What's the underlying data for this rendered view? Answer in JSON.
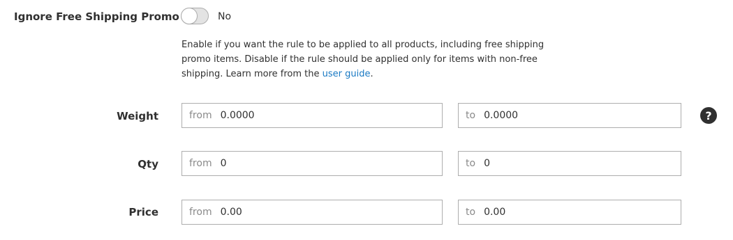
{
  "ignore_promo": {
    "label": "Ignore Free Shipping Promo",
    "toggle_state": "No",
    "note_text": "Enable if you want the rule to be applied to all products, including free shipping promo items. Disable if the rule should be applied only for items with non-free shipping. Learn more from the ",
    "note_link": "user guide",
    "note_end": "."
  },
  "ranges": {
    "weight": {
      "label": "Weight",
      "from_prefix": "from",
      "from_value": "0.0000",
      "to_prefix": "to",
      "to_value": "0.0000"
    },
    "qty": {
      "label": "Qty",
      "from_prefix": "from",
      "from_value": "0",
      "to_prefix": "to",
      "to_value": "0"
    },
    "price": {
      "label": "Price",
      "from_prefix": "from",
      "from_value": "0.00",
      "to_prefix": "to",
      "to_value": "0.00"
    }
  },
  "help_icon": {
    "glyph": "?"
  },
  "colors": {
    "link": "#1979c3",
    "text": "#303030",
    "border": "#adadad",
    "placeholder": "#8a8a8a"
  }
}
